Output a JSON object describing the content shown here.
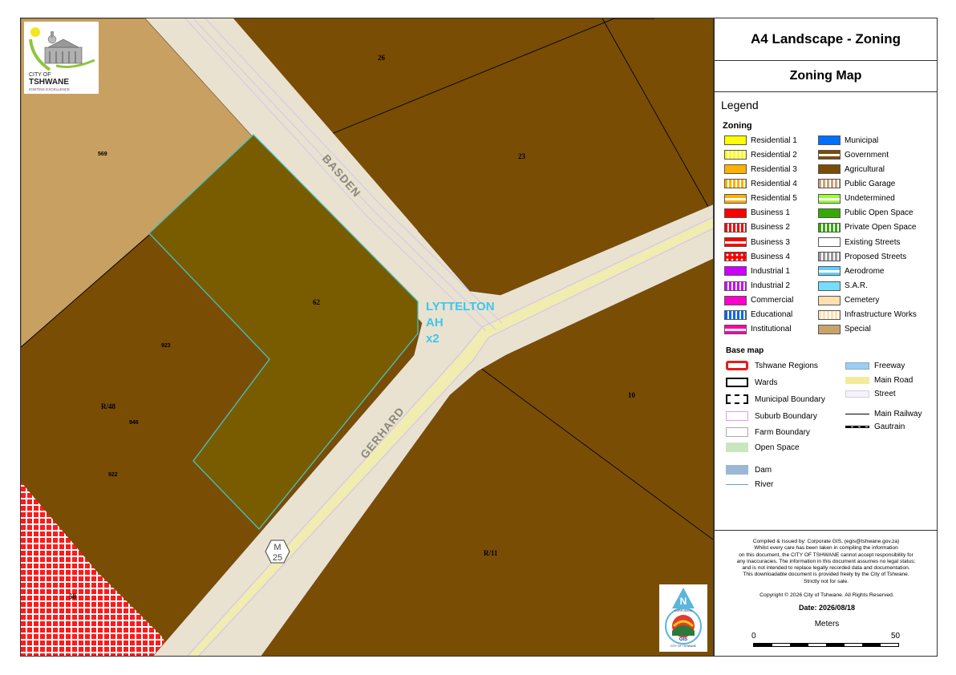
{
  "map": {
    "road_labels": [
      "BASDEN",
      "GERHARD"
    ],
    "route_shield": "M\n25",
    "route_shield_parts": [
      "M",
      "25"
    ],
    "area_label": [
      "LYTTELTON",
      "AH",
      "x2"
    ],
    "parcel_labels": [
      "26",
      "23",
      "569",
      "62",
      "923",
      "R/48",
      "946",
      "922",
      "10",
      "R/11",
      "58"
    ]
  },
  "logo": {
    "line1": "CITY OF",
    "line2": "TSHWANE",
    "line3": "IGNITING EXCELLENCE"
  },
  "panel": {
    "title": "A4 Landscape - Zoning",
    "subtitle": "Zoning Map",
    "legend_title": "Legend",
    "zoning_title": "Zoning",
    "zoning_col1": [
      {
        "label": "Residential 1",
        "color": "#ffff00",
        "pattern": "solid"
      },
      {
        "label": "Residential 2",
        "color": "#ffff00",
        "pattern": "vstripe-white"
      },
      {
        "label": "Residential 3",
        "color": "#ffb000",
        "pattern": "solid"
      },
      {
        "label": "Residential 4",
        "color": "#ffb000",
        "pattern": "vstripe-white"
      },
      {
        "label": "Residential 5",
        "color": "#ffb000",
        "pattern": "hline-white"
      },
      {
        "label": "Business 1",
        "color": "#ff0000",
        "pattern": "solid"
      },
      {
        "label": "Business 2",
        "color": "#ff0000",
        "pattern": "vstripe-white"
      },
      {
        "label": "Business 3",
        "color": "#ff0000",
        "pattern": "hline-white"
      },
      {
        "label": "Business 4",
        "color": "#ff0000",
        "pattern": "dots-white"
      },
      {
        "label": "Industrial 1",
        "color": "#cc00ff",
        "pattern": "solid"
      },
      {
        "label": "Industrial 2",
        "color": "#cc00ff",
        "pattern": "vstripe-white"
      },
      {
        "label": "Commercial",
        "color": "#ff00cc",
        "pattern": "solid"
      },
      {
        "label": "Educational",
        "color": "#0066ff",
        "pattern": "vstripe-white"
      },
      {
        "label": "Institutional",
        "color": "#ff00aa",
        "pattern": "hline-white"
      }
    ],
    "zoning_col2": [
      {
        "label": "Municipal",
        "color": "#0070ff",
        "pattern": "solid"
      },
      {
        "label": "Government",
        "color": "#7a4d05",
        "pattern": "hline-white"
      },
      {
        "label": "Agricultural",
        "color": "#7a4d05",
        "pattern": "solid"
      },
      {
        "label": "Public Garage",
        "color": "#c8a07a",
        "pattern": "vstripe-white"
      },
      {
        "label": "Undetermined",
        "color": "#99ff33",
        "pattern": "hline-white"
      },
      {
        "label": "Public Open Space",
        "color": "#33aa00",
        "pattern": "solid"
      },
      {
        "label": "Private Open Space",
        "color": "#33aa00",
        "pattern": "vstripe-white"
      },
      {
        "label": "Existing Streets",
        "color": "#ffffff",
        "pattern": "solid"
      },
      {
        "label": "Proposed Streets",
        "color": "#999999",
        "pattern": "vstripe-white"
      },
      {
        "label": "Aerodrome",
        "color": "#66ccff",
        "pattern": "hline-white"
      },
      {
        "label": "S.A.R.",
        "color": "#77ddff",
        "pattern": "solid"
      },
      {
        "label": "Cemetery",
        "color": "#ffe0b0",
        "pattern": "solid"
      },
      {
        "label": "Infrastructure Works",
        "color": "#ffe0b0",
        "pattern": "vstripe-white"
      },
      {
        "label": "Special",
        "color": "#c8a46a",
        "pattern": "solid"
      }
    ],
    "basemap_title": "Base map",
    "basemap_col1": [
      {
        "label": "Tshwane Regions",
        "style": "region"
      },
      {
        "label": "Wards",
        "style": "ward"
      },
      {
        "label": "Municipal Boundary",
        "style": "municipal"
      },
      {
        "label": "Suburb Boundary",
        "style": "suburb"
      },
      {
        "label": "Farm Boundary",
        "style": "farm"
      },
      {
        "label": "Open Space",
        "style": "openspace"
      },
      {
        "label": "Dam",
        "style": "dam"
      },
      {
        "label": "River",
        "style": "river"
      }
    ],
    "basemap_col2": [
      {
        "label": "Freeway",
        "style": "freeway"
      },
      {
        "label": "Main Road",
        "style": "mainroad"
      },
      {
        "label": "Street",
        "style": "street"
      },
      {
        "label": "Main Railway",
        "style": "railway"
      },
      {
        "label": "Gautrain",
        "style": "gautrain"
      }
    ],
    "info_lines": [
      "Compiled & Issued by: Corporate GIS, (egis@tshwane.gov.za)",
      "Whilst every care has been taken in compiling the information",
      "on this document, the CITY OF TSHWANE cannot accept responsibility for",
      "any inaccuracies. The information in this document assumes no legal status;",
      "and is not intended to replace legally recorded data and documentation.",
      "This downloadable document is provided freely by the City of Tshwane.",
      "Strictly not for sale."
    ],
    "copyright": "Copyright © 2026 City of Tshwane.  All Rights Reserved.",
    "date": "Date: 2026/08/18",
    "scale_unit": "Meters",
    "scale_min": "0",
    "scale_max": "50"
  },
  "gis_logo": {
    "north": "N",
    "text": "GIS",
    "ring_top": "CORPORATE",
    "ring_bottom": "CITY OF TSHWANE"
  }
}
